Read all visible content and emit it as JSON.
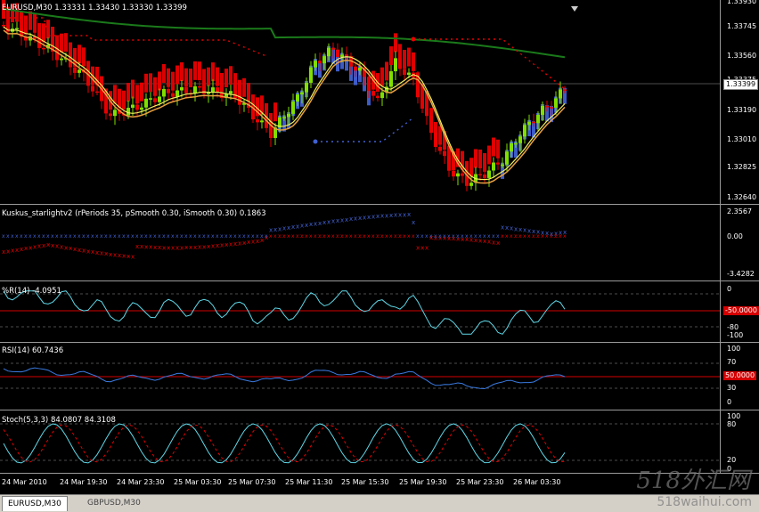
{
  "main": {
    "title": "EURUSD,M30  1.33331 1.33430 1.33330 1.33399",
    "price_ticks": [
      "1.33930",
      "1.33745",
      "1.33560",
      "1.33375",
      "1.33190",
      "1.33010",
      "1.32825",
      "1.32640"
    ],
    "current_price": "1.33399"
  },
  "kuskus": {
    "title": "Kuskus_starlightv2 (rPeriods 35, pSmooth 0.30, iSmooth 0.30)  0.1863",
    "ticks": [
      "2.3567",
      "0.00",
      "-3.4282"
    ]
  },
  "wpr": {
    "title": "%R(14) -4.0951",
    "ticks": [
      "0",
      "-50.0000",
      "-80",
      "-100"
    ]
  },
  "rsi": {
    "title": "RSI(14) 60.7436",
    "ticks": [
      "100",
      "70",
      "50.0000",
      "30",
      "0"
    ]
  },
  "stoch": {
    "title": "Stoch(5,3,3) 84.0807 84.3108",
    "ticks": [
      "100",
      "80",
      "20",
      "0"
    ]
  },
  "time_labels": [
    "24 Mar 2010",
    "24 Mar 19:30",
    "24 Mar 23:30",
    "25 Mar 03:30",
    "25 Mar 07:30",
    "25 Mar 11:30",
    "25 Mar 15:30",
    "25 Mar 19:30",
    "25 Mar 23:30",
    "26 Mar 03:30"
  ],
  "tabs": [
    "EURUSD,M30",
    "GBPUSD,M30"
  ],
  "watermark": {
    "cn": "518外汇网",
    "url": "518waihui.com"
  },
  "colors": {
    "bull": "#7fe000",
    "bear": "#e80000",
    "ma_green": "#1a7a1a",
    "ma_orange": "#e8a040",
    "ma_yellow": "#f0f060",
    "blue_band": "#4060d0",
    "cyan": "#5fd8e8",
    "red_line": "#d40000"
  }
}
